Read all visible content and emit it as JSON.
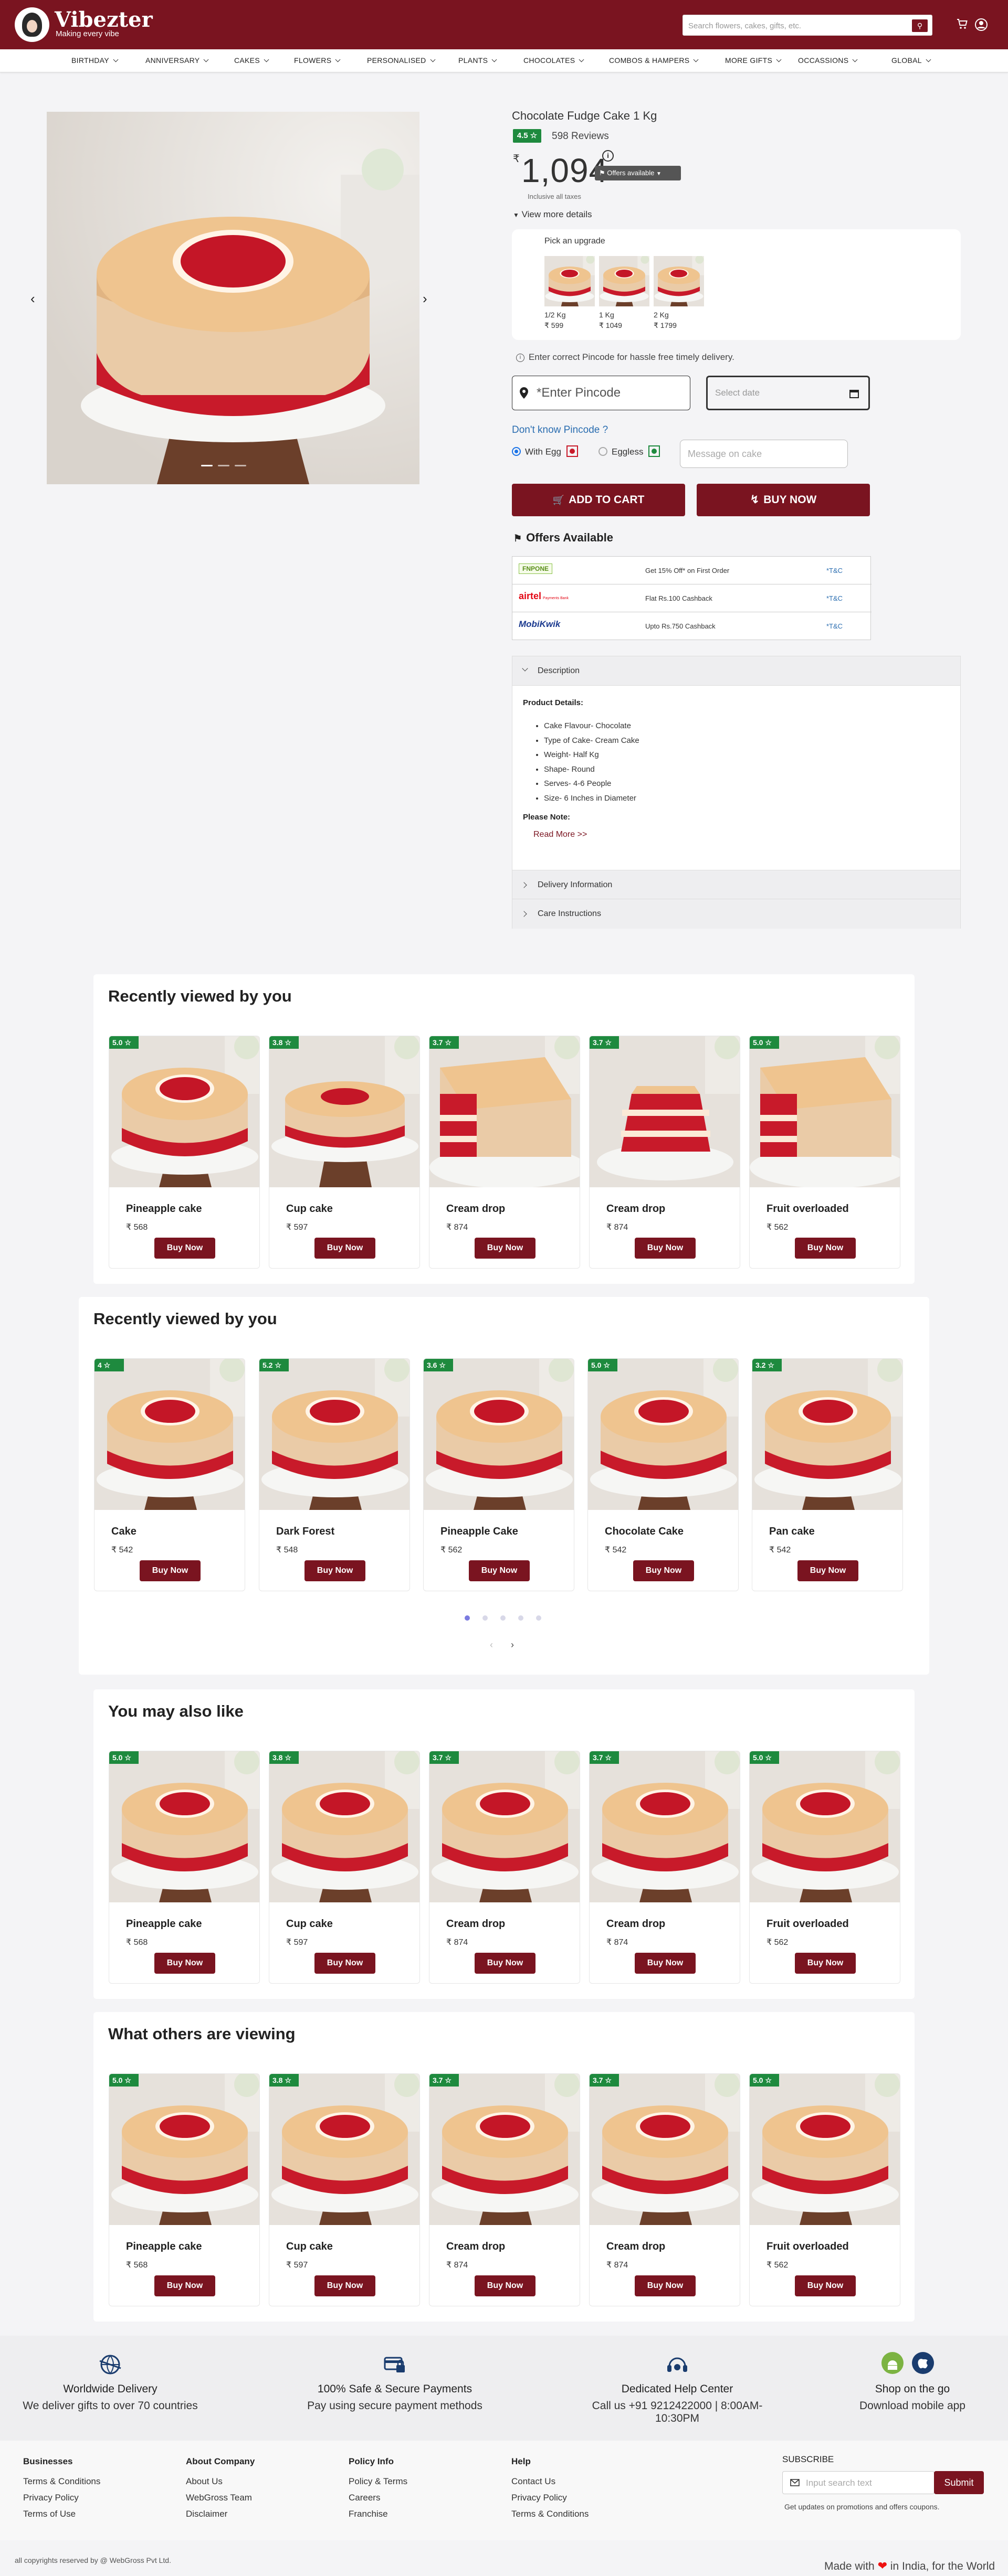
{
  "brand": {
    "name": "Vibezter",
    "tagline": "Making every vibe",
    "colors": {
      "primary": "#7a1420",
      "rating": "#1e8a3e",
      "link": "#2a6db0"
    }
  },
  "search": {
    "placeholder": "Search flowers, cakes, gifts, etc.",
    "icon": "search-icon"
  },
  "header_icons": [
    "cart-icon",
    "user-icon"
  ],
  "nav": [
    "BIRTHDAY",
    "ANNIVERSARY",
    "CAKES",
    "FLOWERS",
    "PERSONALISED",
    "PLANTS",
    "CHOCOLATES",
    "COMBOS & HAMPERS",
    "MORE GIFTS",
    "OCCASSIONS",
    "GLOBAL"
  ],
  "product": {
    "title": "Chocolate Fudge Cake 1 Kg",
    "rating": "4.5 ☆",
    "reviews": "598 Reviews",
    "currency": "₹",
    "price": "1,094",
    "offers_badge": "Offers available",
    "inclusive": "Inclusive all taxes",
    "view_more": "View more details",
    "upgrade_title": "Pick an upgrade",
    "upgrades": [
      {
        "weight": "1/2 Kg",
        "price": "₹ 599"
      },
      {
        "weight": "1 Kg",
        "price": "₹ 1049"
      },
      {
        "weight": "2 Kg",
        "price": "₹ 1799"
      }
    ],
    "pincode_note": "Enter correct Pincode for hassle free timely delivery.",
    "pincode_placeholder": "*Enter Pincode",
    "date_placeholder": "Select date",
    "dont_know": "Don't know Pincode ?",
    "with_egg": "With Egg",
    "eggless": "Eggless",
    "egg_option_selected": "With Egg",
    "message_placeholder": "Message on cake",
    "add_to_cart": "ADD TO CART",
    "buy_now": "BUY NOW",
    "offers_heading": "Offers Available",
    "offers": [
      {
        "logo": "FNPONE",
        "text": "Get 15% Off* on First Order",
        "tc": "*T&C"
      },
      {
        "logo": "airtel",
        "logo_sub": "Payments Bank",
        "text": "Flat Rs.100 Cashback",
        "tc": "*T&C"
      },
      {
        "logo": "MobiKwik",
        "text": "Upto Rs.750 Cashback",
        "tc": "*T&C"
      }
    ],
    "description_tab": "Description",
    "product_details_heading": "Product Details:",
    "details": [
      "Cake Flavour- Chocolate",
      "Type of Cake- Cream Cake",
      "Weight- Half Kg",
      "Shape- Round",
      "Serves- 4-6 People",
      "Size- 6 Inches in Diameter"
    ],
    "please_note": "Please Note:",
    "read_more": "Read More >>",
    "delivery_tab": "Delivery Information",
    "care_tab": "Care Instructions"
  },
  "sections": [
    {
      "title": "Recently viewed by you",
      "items": [
        {
          "name": "Pineapple cake",
          "price": "₹ 568",
          "rating": "5.0 ☆",
          "button": "Buy Now"
        },
        {
          "name": "Cup cake",
          "price": "₹ 597",
          "rating": "3.8 ☆",
          "button": "Buy Now"
        },
        {
          "name": "Cream drop",
          "price": "₹ 874",
          "rating": "3.7 ☆",
          "button": "Buy Now"
        },
        {
          "name": "Cream drop",
          "price": "₹ 874",
          "rating": "3.7 ☆",
          "button": "Buy Now"
        },
        {
          "name": "Fruit overloaded",
          "price": "₹ 562",
          "rating": "5.0 ☆",
          "button": "Buy Now"
        }
      ]
    },
    {
      "title": "Recently viewed by you",
      "items": [
        {
          "name": "Cake",
          "price": "₹ 542",
          "rating": "4 ☆",
          "button": "Buy Now"
        },
        {
          "name": "Dark Forest",
          "price": "₹ 548",
          "rating": "5.2 ☆",
          "button": "Buy Now"
        },
        {
          "name": "Pineapple Cake",
          "price": "₹ 562",
          "rating": "3.6 ☆",
          "button": "Buy Now"
        },
        {
          "name": "Chocolate Cake",
          "price": "₹ 542",
          "rating": "5.0 ☆",
          "button": "Buy Now"
        },
        {
          "name": "Pan cake",
          "price": "₹ 542",
          "rating": "3.2 ☆",
          "button": "Buy Now"
        }
      ],
      "pagination": {
        "prev": "‹",
        "next": "›",
        "page": 1,
        "pages": 5
      }
    },
    {
      "title": "You may also like",
      "items": [
        {
          "name": "Pineapple cake",
          "price": "₹ 568",
          "rating": "5.0 ☆",
          "button": "Buy Now"
        },
        {
          "name": "Cup cake",
          "price": "₹ 597",
          "rating": "3.8 ☆",
          "button": "Buy Now"
        },
        {
          "name": "Cream drop",
          "price": "₹ 874",
          "rating": "3.7 ☆",
          "button": "Buy Now"
        },
        {
          "name": "Cream drop",
          "price": "₹ 874",
          "rating": "3.7 ☆",
          "button": "Buy Now"
        },
        {
          "name": "Fruit overloaded",
          "price": "₹ 562",
          "rating": "5.0 ☆",
          "button": "Buy Now"
        }
      ]
    },
    {
      "title": "What others are viewing",
      "items": [
        {
          "name": "Pineapple cake",
          "price": "₹ 568",
          "rating": "5.0 ☆",
          "button": "Buy Now"
        },
        {
          "name": "Cup cake",
          "price": "₹ 597",
          "rating": "3.8 ☆",
          "button": "Buy Now"
        },
        {
          "name": "Cream drop",
          "price": "₹ 874",
          "rating": "3.7 ☆",
          "button": "Buy Now"
        },
        {
          "name": "Cream drop",
          "price": "₹ 874",
          "rating": "3.7 ☆",
          "button": "Buy Now"
        },
        {
          "name": "Fruit overloaded",
          "price": "₹ 562",
          "rating": "5.0 ☆",
          "button": "Buy Now"
        }
      ]
    }
  ],
  "features": [
    {
      "icon": "globe-delivery-icon",
      "title": "Worldwide Delivery",
      "subtitle": "We deliver gifts to over 70 countries"
    },
    {
      "icon": "secure-payment-icon",
      "title": "100% Safe & Secure Payments",
      "subtitle": "Pay using secure payment methods"
    },
    {
      "icon": "headset-icon",
      "title": "Dedicated Help Center",
      "subtitle": "Call us +91 9212422000 | 8:00AM-10:30PM"
    },
    {
      "icon": "app-store-icon",
      "title": "Shop on the go",
      "subtitle": "Download mobile app"
    }
  ],
  "footer": {
    "columns": [
      {
        "heading": "Businesses",
        "links": [
          "Terms & Conditions",
          "Privacy Policy",
          "Terms of Use"
        ]
      },
      {
        "heading": "About Company",
        "links": [
          "About Us",
          "WebGross Team",
          "Disclaimer"
        ]
      },
      {
        "heading": "Policy Info",
        "links": [
          "Policy & Terms",
          "Careers",
          "Franchise"
        ]
      },
      {
        "heading": "Help",
        "links": [
          "Contact Us",
          "Privacy Policy",
          "Terms & Conditions"
        ]
      }
    ],
    "subscribe": {
      "heading": "SUBSCRIBE",
      "placeholder": "Input search text",
      "button": "Submit",
      "note": "Get updates on promotions and offers coupons."
    },
    "copyright": "all copyrights reserved by @ WebGross Pvt Ltd.",
    "made_pre": "Made with",
    "made_post": "in India, for the World"
  }
}
